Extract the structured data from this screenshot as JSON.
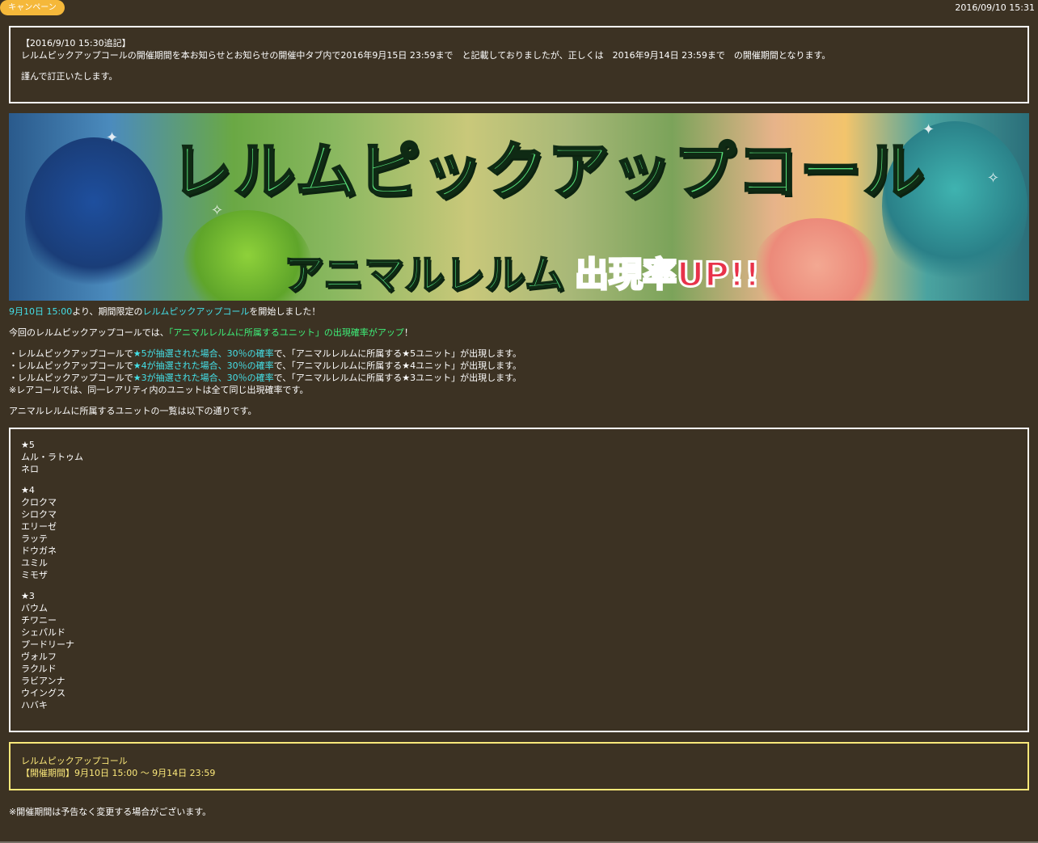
{
  "header": {
    "tag_label": "キャンペーン",
    "timestamp": "2016/09/10 15:31"
  },
  "notice": {
    "heading": "【2016/9/10 15:30追記】",
    "body": "レルムピックアップコールの開催期間を本お知らせとお知らせの開催中タブ内で2016年9月15日 23:59まで　と記載しておりましたが、正しくは　2016年9月14日 23:59まで　の開催期間となります。",
    "apology": "謹んで訂正いたします。"
  },
  "banner": {
    "title": "レルムピックアップコール",
    "subtitle": "アニマルレルム",
    "highlight": "出現率UP!!"
  },
  "intro": {
    "start_date": "9月10日 15:00",
    "text1": "より、期間限定の",
    "event_name": "レルムピックアップコール",
    "text2": "を開始しました！",
    "line2_prefix": "今回のレルムピックアップコールでは、",
    "line2_highlight": "「アニマルレルムに所属するユニット」の出現確率がアップ",
    "line2_suffix": "！"
  },
  "rates": [
    {
      "prefix": "・レルムピックアップコールで",
      "highlight": "★5が抽選された場合、30％の確率",
      "suffix": "で、「アニマルレルムに所属する★5ユニット」が出現します。"
    },
    {
      "prefix": "・レルムピックアップコールで",
      "highlight": "★4が抽選された場合、30％の確率",
      "suffix": "で、「アニマルレルムに所属する★4ユニット」が出現します。"
    },
    {
      "prefix": "・レルムピックアップコールで",
      "highlight": "★3が抽選された場合、30％の確率",
      "suffix": "で、「アニマルレルムに所属する★3ユニット」が出現します。"
    }
  ],
  "rare_note": "※レアコールでは、同一レアリティ内のユニットは全て同じ出現確率です。",
  "list_intro": "アニマルレルムに所属するユニットの一覧は以下の通りです。",
  "units": {
    "star5": {
      "label": "★5",
      "names": [
        "ムル・ラトゥム",
        "ネロ"
      ]
    },
    "star4": {
      "label": "★4",
      "names": [
        "クロクマ",
        "シロクマ",
        "エリーゼ",
        "ラッテ",
        "ドウガネ",
        "ユミル",
        "ミモザ"
      ]
    },
    "star3": {
      "label": "★3",
      "names": [
        "バウム",
        "チワニー",
        "シェパルド",
        "プードリーナ",
        "ヴォルフ",
        "ラクルド",
        "ラビアンナ",
        "ウイングス",
        "ハバキ"
      ]
    }
  },
  "period": {
    "name": "レルムピックアップコール",
    "dates": "【開催期間】9月10日 15:00 ～ 9月14日 23:59"
  },
  "footer_note": "※開催期間は予告なく変更する場合がございます。",
  "colors": {
    "background": "#3c3223",
    "tag": "#f5b83a",
    "cyan": "#44e0e8",
    "green": "#3ef27a",
    "period_border": "#fbe87a"
  }
}
